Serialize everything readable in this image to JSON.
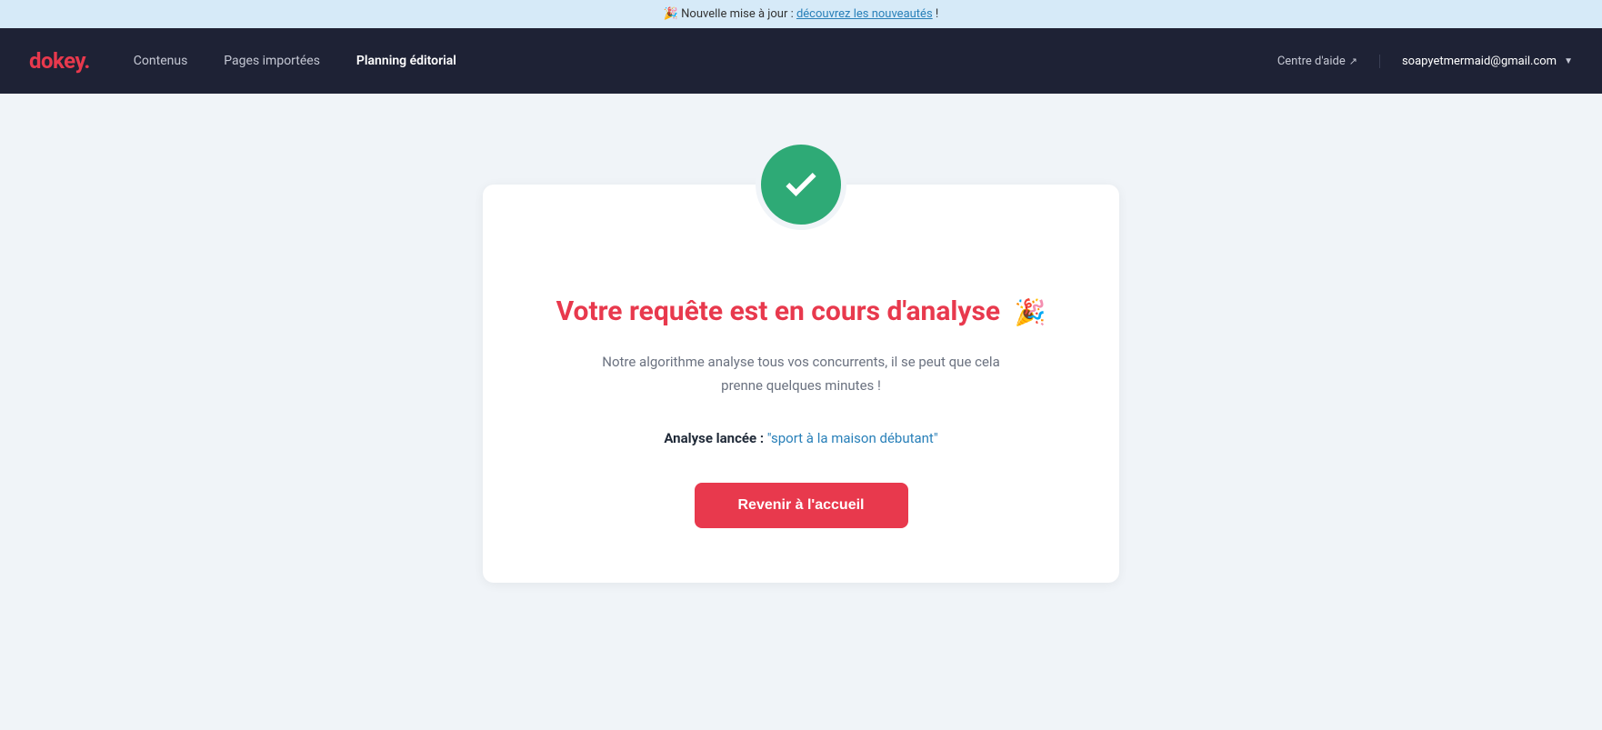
{
  "announcement": {
    "text_before": "🎉 Nouvelle mise à jour : ",
    "link_text": "découvrez les nouveautés",
    "text_after": " !"
  },
  "navbar": {
    "logo": "dokey",
    "logo_dot": ".",
    "nav_items": [
      {
        "label": "Contenus",
        "active": false
      },
      {
        "label": "Pages importées",
        "active": false
      },
      {
        "label": "Planning éditorial",
        "active": true
      }
    ],
    "help_label": "Centre d'aide",
    "user_email": "soapyetmermaid@gmail.com"
  },
  "main": {
    "title": "Votre requête est en cours d'analyse",
    "title_emoji": "🎉",
    "subtitle_line1": "Notre algorithme analyse tous vos concurrents, il se peut que cela",
    "subtitle_line2": "prenne quelques minutes !",
    "analysis_label": "Analyse lancée :",
    "analysis_keyword": "\"sport à la maison débutant\"",
    "back_button_label": "Revenir à l'accueil"
  }
}
